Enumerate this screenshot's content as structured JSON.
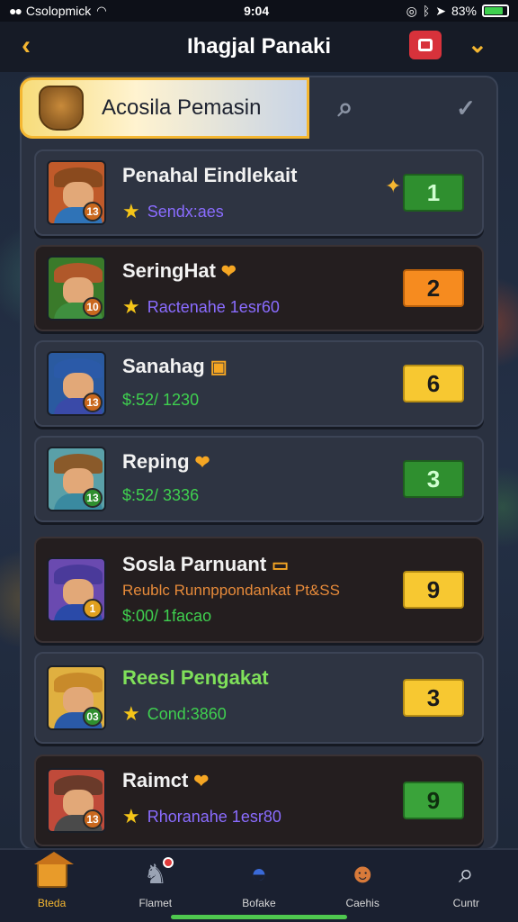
{
  "status_bar": {
    "carrier": "Csolopmick",
    "time": "9:04",
    "battery": "83%",
    "battery_level": 0.83
  },
  "header": {
    "back_icon": "chevron-left-icon",
    "title": "Ihagjal Panaki",
    "action_icon": "record-icon",
    "menu_icon": "chevron-down-icon"
  },
  "search": {
    "active_tab_label": "Acosila Pemasin",
    "tab2_icon": "search-icon",
    "tab3_icon": "check-icon"
  },
  "players": [
    {
      "name": "Penahal Eindlekait",
      "sub": "Sendx:aes",
      "sub_style": "purple",
      "score": "1",
      "score_style": "green",
      "level": "13",
      "badge_color": "#c9681e",
      "hat": "#8a4a1e",
      "body": "#2f73b7",
      "bg": "#c05a2a",
      "star": true,
      "gem": true,
      "tag": "",
      "note": ""
    },
    {
      "name": "SeringHat",
      "sub": "Ractenahe 1esr60",
      "sub_style": "purple",
      "score": "2",
      "score_style": "orange",
      "level": "10",
      "badge_color": "#c9681e",
      "hat": "#b0582a",
      "body": "#3f8f3f",
      "bg": "#3a7a2a",
      "star": true,
      "gem": false,
      "tag": "heart-icon",
      "note": ""
    },
    {
      "name": "Sanahag",
      "sub": "$:52/ 1230",
      "sub_style": "green",
      "score": "6",
      "score_style": "yellow",
      "level": "13",
      "badge_color": "#c9681e",
      "hat": "#2b5aa8",
      "body": "#3a4aa8",
      "bg": "#2a5aa0",
      "star": false,
      "gem": false,
      "tag": "coin-icon",
      "note": ""
    },
    {
      "name": "Reping",
      "sub": "$:52/ 3336",
      "sub_style": "green",
      "score": "3",
      "score_style": "green",
      "level": "13",
      "badge_color": "#2f8f2f",
      "hat": "#8a5a2a",
      "body": "#3a8aa0",
      "bg": "#5aa0a8",
      "star": false,
      "gem": false,
      "tag": "heart-icon",
      "note": ""
    },
    {
      "name": "Sosla Parnuant",
      "sub": "$:00/ 1facao",
      "sub_style": "green",
      "score": "9",
      "score_style": "yellow",
      "level": "1",
      "badge_color": "#e0a020",
      "hat": "#4a3a9a",
      "body": "#2a4aa8",
      "bg": "#6a4ab0",
      "star": false,
      "gem": false,
      "tag": "ticket-icon",
      "note": "Reublc Runnppondankat Pt&SS"
    },
    {
      "name": "Reesl Pengakat",
      "sub": "Cond:3860",
      "sub_style": "green",
      "score": "3",
      "score_style": "yellow",
      "level": "03",
      "badge_color": "#2f8f2f",
      "hat": "#c88a2a",
      "body": "#2a5aa8",
      "bg": "#e0b040",
      "star": true,
      "gem": false,
      "tag": "",
      "note": ""
    },
    {
      "name": "Raimct",
      "sub": "Rhoranahe 1esr80",
      "sub_style": "purple",
      "score": "9",
      "score_style": "lgreen",
      "level": "13",
      "badge_color": "#c9681e",
      "hat": "#6a3a2a",
      "body": "#4a4a4a",
      "bg": "#c04a3a",
      "star": true,
      "gem": false,
      "tag": "heart-icon",
      "note": ""
    }
  ],
  "bottom_nav": [
    {
      "label": "Bteda",
      "icon": "home-icon",
      "active": true
    },
    {
      "label": "Flamet",
      "icon": "knight-icon",
      "active": false
    },
    {
      "label": "Bofake",
      "icon": "helmet-icon",
      "active": false
    },
    {
      "label": "Caehis",
      "icon": "hero-icon",
      "active": false
    },
    {
      "label": "Cuntr",
      "icon": "search-icon",
      "active": false
    }
  ],
  "colors": {
    "accent": "#f5b731",
    "score_green": "#2f8f2f",
    "score_orange": "#f68b1f",
    "score_yellow": "#f7c831",
    "sub_purple": "#8a6cff",
    "sub_green": "#3fd04f"
  }
}
